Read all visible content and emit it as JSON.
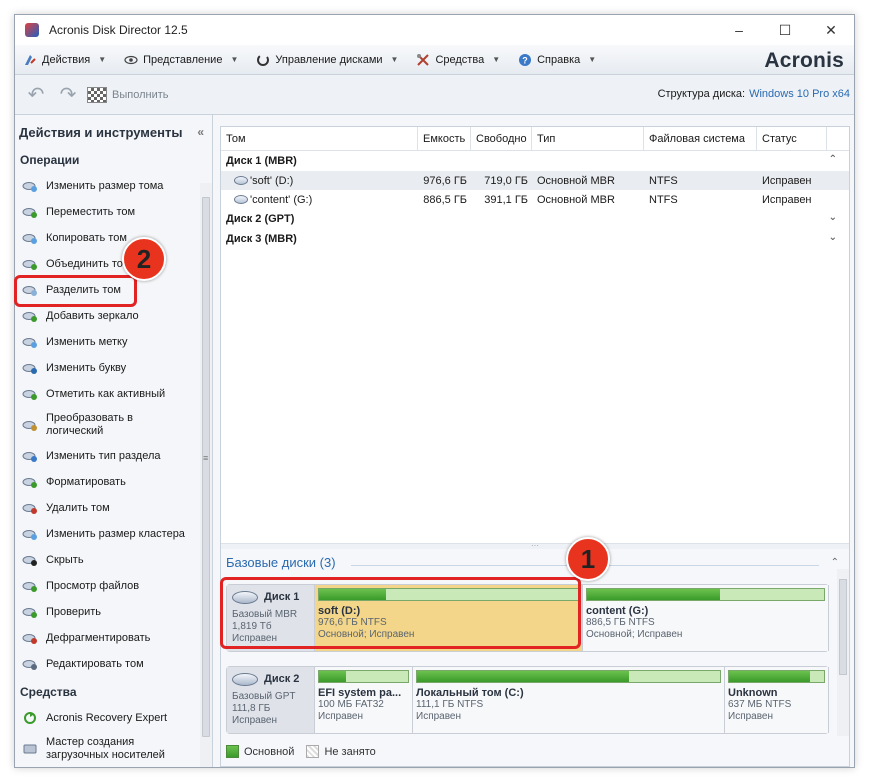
{
  "window": {
    "title": "Acronis Disk Director 12.5",
    "minimize": "–",
    "maximize": "☐",
    "close": "✕"
  },
  "menubar": {
    "items": [
      "Действия",
      "Представление",
      "Управление дисками",
      "Средства",
      "Справка"
    ],
    "brand": "Acronis"
  },
  "toolbar": {
    "run_label": "Выполнить",
    "structure_label": "Структура диска:",
    "structure_value": "Windows 10 Pro x64"
  },
  "sidebar": {
    "header": "Действия и инструменты",
    "collapse": "«",
    "section_ops": "Операции",
    "ops": [
      "Изменить размер тома",
      "Переместить том",
      "Копировать том",
      "Объединить тома",
      "Разделить том",
      "Добавить зеркало",
      "Изменить метку",
      "Изменить букву",
      "Отметить как активный",
      "Преобразовать в логический",
      "Изменить тип раздела",
      "Форматировать",
      "Удалить том",
      "Изменить размер кластера",
      "Скрыть",
      "Просмотр файлов",
      "Проверить",
      "Дефрагментировать",
      "Редактировать том"
    ],
    "section_tools": "Средства",
    "tools": [
      "Acronis Recovery Expert",
      "Мастер создания загрузочных носителей"
    ]
  },
  "table": {
    "columns": [
      "Том",
      "Емкость",
      "Свободно",
      "Тип",
      "Файловая система",
      "Статус"
    ],
    "groups": [
      {
        "name": "Диск 1 (MBR)",
        "chevron": "⌃",
        "rows": [
          {
            "name": "'soft' (D:)",
            "capacity": "976,6 ГБ",
            "free": "719,0 ГБ",
            "type": "Основной MBR",
            "fs": "NTFS",
            "status": "Исправен"
          },
          {
            "name": "'content' (G:)",
            "capacity": "886,5 ГБ",
            "free": "391,1 ГБ",
            "type": "Основной MBR",
            "fs": "NTFS",
            "status": "Исправен"
          }
        ]
      },
      {
        "name": "Диск 2 (GPT)",
        "chevron": "⌄",
        "rows": []
      },
      {
        "name": "Диск 3 (MBR)",
        "chevron": "⌄",
        "rows": []
      }
    ]
  },
  "diskpane": {
    "title": "Базовые диски (3)",
    "disks": [
      {
        "name": "Диск 1",
        "type": "Базовый MBR",
        "size": "1,819 Тб",
        "status": "Исправен",
        "partitions": [
          {
            "name": "soft (D:)",
            "info": "976,6 ГБ NTFS",
            "status": "Основной; Исправен",
            "used": 0.26,
            "selected": true
          },
          {
            "name": "content (G:)",
            "info": "886,5 ГБ NTFS",
            "status": "Основной; Исправен",
            "used": 0.56,
            "selected": false
          }
        ]
      },
      {
        "name": "Диск 2",
        "type": "Базовый GPT",
        "size": "111,8 ГБ",
        "status": "Исправен",
        "partitions": [
          {
            "name": "EFI system pa...",
            "info": "100 МБ FAT32",
            "status": "Исправен",
            "used": 0.3,
            "selected": false
          },
          {
            "name": "Локальный том (C:)",
            "info": "111,1 ГБ NTFS",
            "status": "Исправен",
            "used": 0.7,
            "selected": false
          },
          {
            "name": "Unknown",
            "info": "637 МБ NTFS",
            "status": "Исправен",
            "used": 0.85,
            "selected": false
          }
        ]
      }
    ],
    "legend": {
      "primary": "Основной",
      "free": "Не занято"
    }
  },
  "annotations": {
    "badge1": "1",
    "badge2": "2"
  },
  "colors": {
    "accent": "#2a6ab0",
    "highlight": "#e22323",
    "selected_partition": "#f3d68a",
    "bar_fill": "#3a9a2a"
  }
}
